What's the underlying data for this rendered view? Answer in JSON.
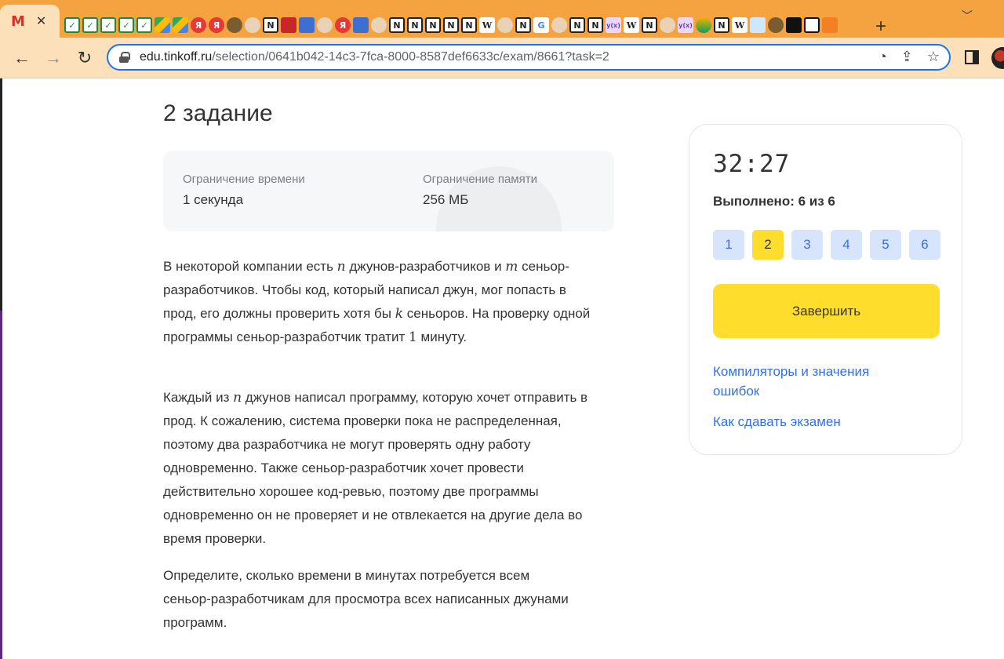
{
  "browser": {
    "active_tab_icon": "gmail-icon",
    "tab_close": "✕",
    "new_tab": "+",
    "url_host": "edu.tinkoff.ru",
    "url_path": "/selection/0641b042-14c3-7fca-8000-8587def6633c/exam/8661?task=2"
  },
  "page": {
    "title": "2 задание",
    "limits": {
      "time_label": "Ограничение времени",
      "time_value": "1 секунда",
      "memory_label": "Ограничение памяти",
      "memory_value": "256 МБ"
    },
    "p1": {
      "t1": "В некоторой компании есть ",
      "v1": "n",
      "t2": " джунов-разработчиков и ",
      "v2": "m",
      "t3": " сеньор-разработчиков. Чтобы код, который написал джун, мог попасть в прод, его должны проверить хотя бы ",
      "v3": "k",
      "t4": " сеньоров. На проверку одной программы сеньор-разработчик тратит ",
      "v4": "1",
      "t5": " минуту."
    },
    "p2": {
      "t1": "Каждый из ",
      "v1": "n",
      "t2": " джунов написал программу, которую хочет отправить в прод. К сожалению, система проверки пока не распределенная, поэтому два разработчика не могут проверять одну работу одновременно. Также сеньор-разработчик хочет провести действительно хорошее код-ревью, поэтому две программы одновременно он не проверяет и не отвлекается на другие дела во время проверки."
    },
    "p3": "Определите, сколько времени в минутах потребуется всем сеньор-разработчикам для просмотра всех написанных джунами программ."
  },
  "sidebar": {
    "timer": "32:27",
    "progress_text": "Выполнено: 6 из 6",
    "tasks": [
      "1",
      "2",
      "3",
      "4",
      "5",
      "6"
    ],
    "active_task": "2",
    "finish_label": "Завершить",
    "link_compilers": "Компиляторы и значения ошибок",
    "link_howto": "Как сдавать экзамен"
  },
  "colors": {
    "accent_yellow": "#ffdd2d",
    "link_blue": "#336fee",
    "task_chip_bg": "#d6e4fc",
    "tab_strip": "#f4a340"
  }
}
